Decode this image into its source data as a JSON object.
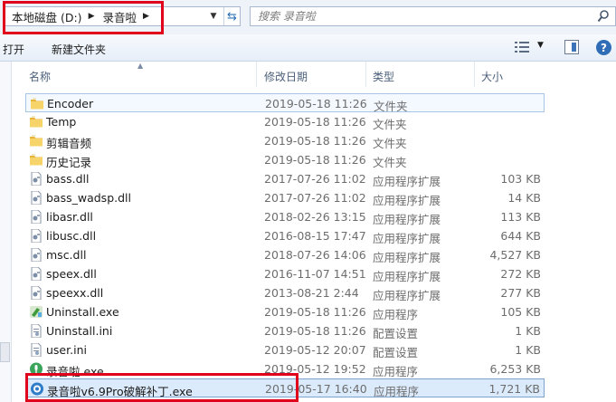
{
  "address": {
    "segments": [
      "本地磁盘 (D:)",
      "录音啦"
    ],
    "separator": "▶",
    "dropdown": "▼",
    "refresh": "⇆"
  },
  "search": {
    "placeholder": "搜索 录音啦"
  },
  "toolbar": {
    "open_label": "打开",
    "new_folder_label": "新建文件夹",
    "view_dropdown": "▼",
    "help": "?"
  },
  "columns": {
    "name": "名称",
    "modified": "修改日期",
    "type": "类型",
    "size": "大小",
    "sort_arrow": "▲"
  },
  "files": [
    {
      "name": "Encoder",
      "date": "2019-05-18 11:26",
      "type": "文件夹",
      "size": "",
      "icon": "folder-icon"
    },
    {
      "name": "Temp",
      "date": "2019-05-18 11:26",
      "type": "文件夹",
      "size": "",
      "icon": "folder-icon"
    },
    {
      "name": "剪辑音频",
      "date": "2019-05-18 11:26",
      "type": "文件夹",
      "size": "",
      "icon": "folder-icon"
    },
    {
      "name": "历史记录",
      "date": "2019-05-18 11:26",
      "type": "文件夹",
      "size": "",
      "icon": "folder-icon"
    },
    {
      "name": "bass.dll",
      "date": "2017-07-26 11:02",
      "type": "应用程序扩展",
      "size": "103 KB",
      "icon": "dll-icon"
    },
    {
      "name": "bass_wadsp.dll",
      "date": "2017-07-26 11:02",
      "type": "应用程序扩展",
      "size": "14 KB",
      "icon": "dll-icon"
    },
    {
      "name": "libasr.dll",
      "date": "2018-02-26 13:15",
      "type": "应用程序扩展",
      "size": "113 KB",
      "icon": "dll-icon"
    },
    {
      "name": "libusc.dll",
      "date": "2016-08-15 17:47",
      "type": "应用程序扩展",
      "size": "644 KB",
      "icon": "dll-icon"
    },
    {
      "name": "msc.dll",
      "date": "2018-07-26 14:06",
      "type": "应用程序扩展",
      "size": "4,527 KB",
      "icon": "dll-icon"
    },
    {
      "name": "speex.dll",
      "date": "2016-11-07 14:51",
      "type": "应用程序扩展",
      "size": "272 KB",
      "icon": "dll-icon"
    },
    {
      "name": "speexx.dll",
      "date": "2013-08-21 2:44",
      "type": "应用程序扩展",
      "size": "277 KB",
      "icon": "dll-icon"
    },
    {
      "name": "Uninstall.exe",
      "date": "2019-05-18 11:26",
      "type": "应用程序",
      "size": "105 KB",
      "icon": "uninstall-exe-icon"
    },
    {
      "name": "Uninstall.ini",
      "date": "2019-05-18 11:26",
      "type": "配置设置",
      "size": "1 KB",
      "icon": "ini-icon"
    },
    {
      "name": "user.ini",
      "date": "2019-05-12 20:07",
      "type": "配置设置",
      "size": "1 KB",
      "icon": "ini-icon"
    },
    {
      "name": "录音啦.exe",
      "date": "2019-05-12 19:52",
      "type": "应用程序",
      "size": "6,253 KB",
      "icon": "app-exe-icon"
    },
    {
      "name": "录音啦v6.9Pro破解补丁.exe",
      "date": "2019-05-17 16:40",
      "type": "应用程序",
      "size": "1,721 KB",
      "icon": "patch-exe-icon"
    }
  ],
  "selected_index": 15,
  "colors": {
    "accent": "#2f6db6",
    "highlight_box": "#e0001b",
    "selection": "#dcebfc"
  }
}
